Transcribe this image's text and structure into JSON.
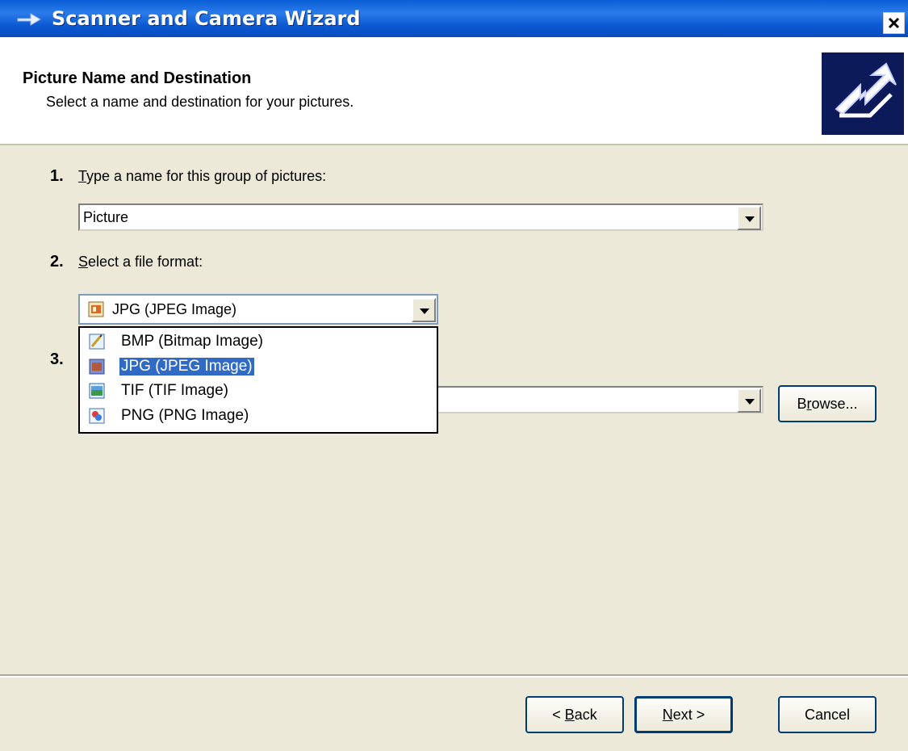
{
  "window": {
    "title": "Scanner and Camera Wizard",
    "close_icon": "close-icon"
  },
  "header": {
    "title": "Picture Name and Destination",
    "subtitle": "Select a name and destination for your pictures."
  },
  "step1": {
    "number": "1.",
    "label_underlined": "T",
    "label_rest": "ype a name for this group of pictures:",
    "value": "Picture"
  },
  "step2": {
    "number": "2.",
    "label_underlined": "S",
    "label_rest": "elect a file format:",
    "selected": "JPG (JPEG Image)",
    "options": [
      {
        "label": "BMP (Bitmap Image)",
        "icon": "bmp-file-icon",
        "selected": false
      },
      {
        "label": "JPG (JPEG Image)",
        "icon": "jpg-file-icon",
        "selected": true
      },
      {
        "label": "TIF (TIF Image)",
        "icon": "tif-file-icon",
        "selected": false
      },
      {
        "label": "PNG (PNG Image)",
        "icon": "png-file-icon",
        "selected": false
      }
    ]
  },
  "step3": {
    "number": "3.",
    "value": "",
    "browse_pre": "B",
    "browse_underlined": "r",
    "browse_post": "owse..."
  },
  "buttons": {
    "back_pre": "< ",
    "back_underlined": "B",
    "back_post": "ack",
    "next_underlined": "N",
    "next_post": "ext >",
    "cancel": "Cancel"
  },
  "colors": {
    "titlebar": "#0A5FD6",
    "dialog_bg": "#ECE9D8",
    "selection": "#316AC5"
  }
}
